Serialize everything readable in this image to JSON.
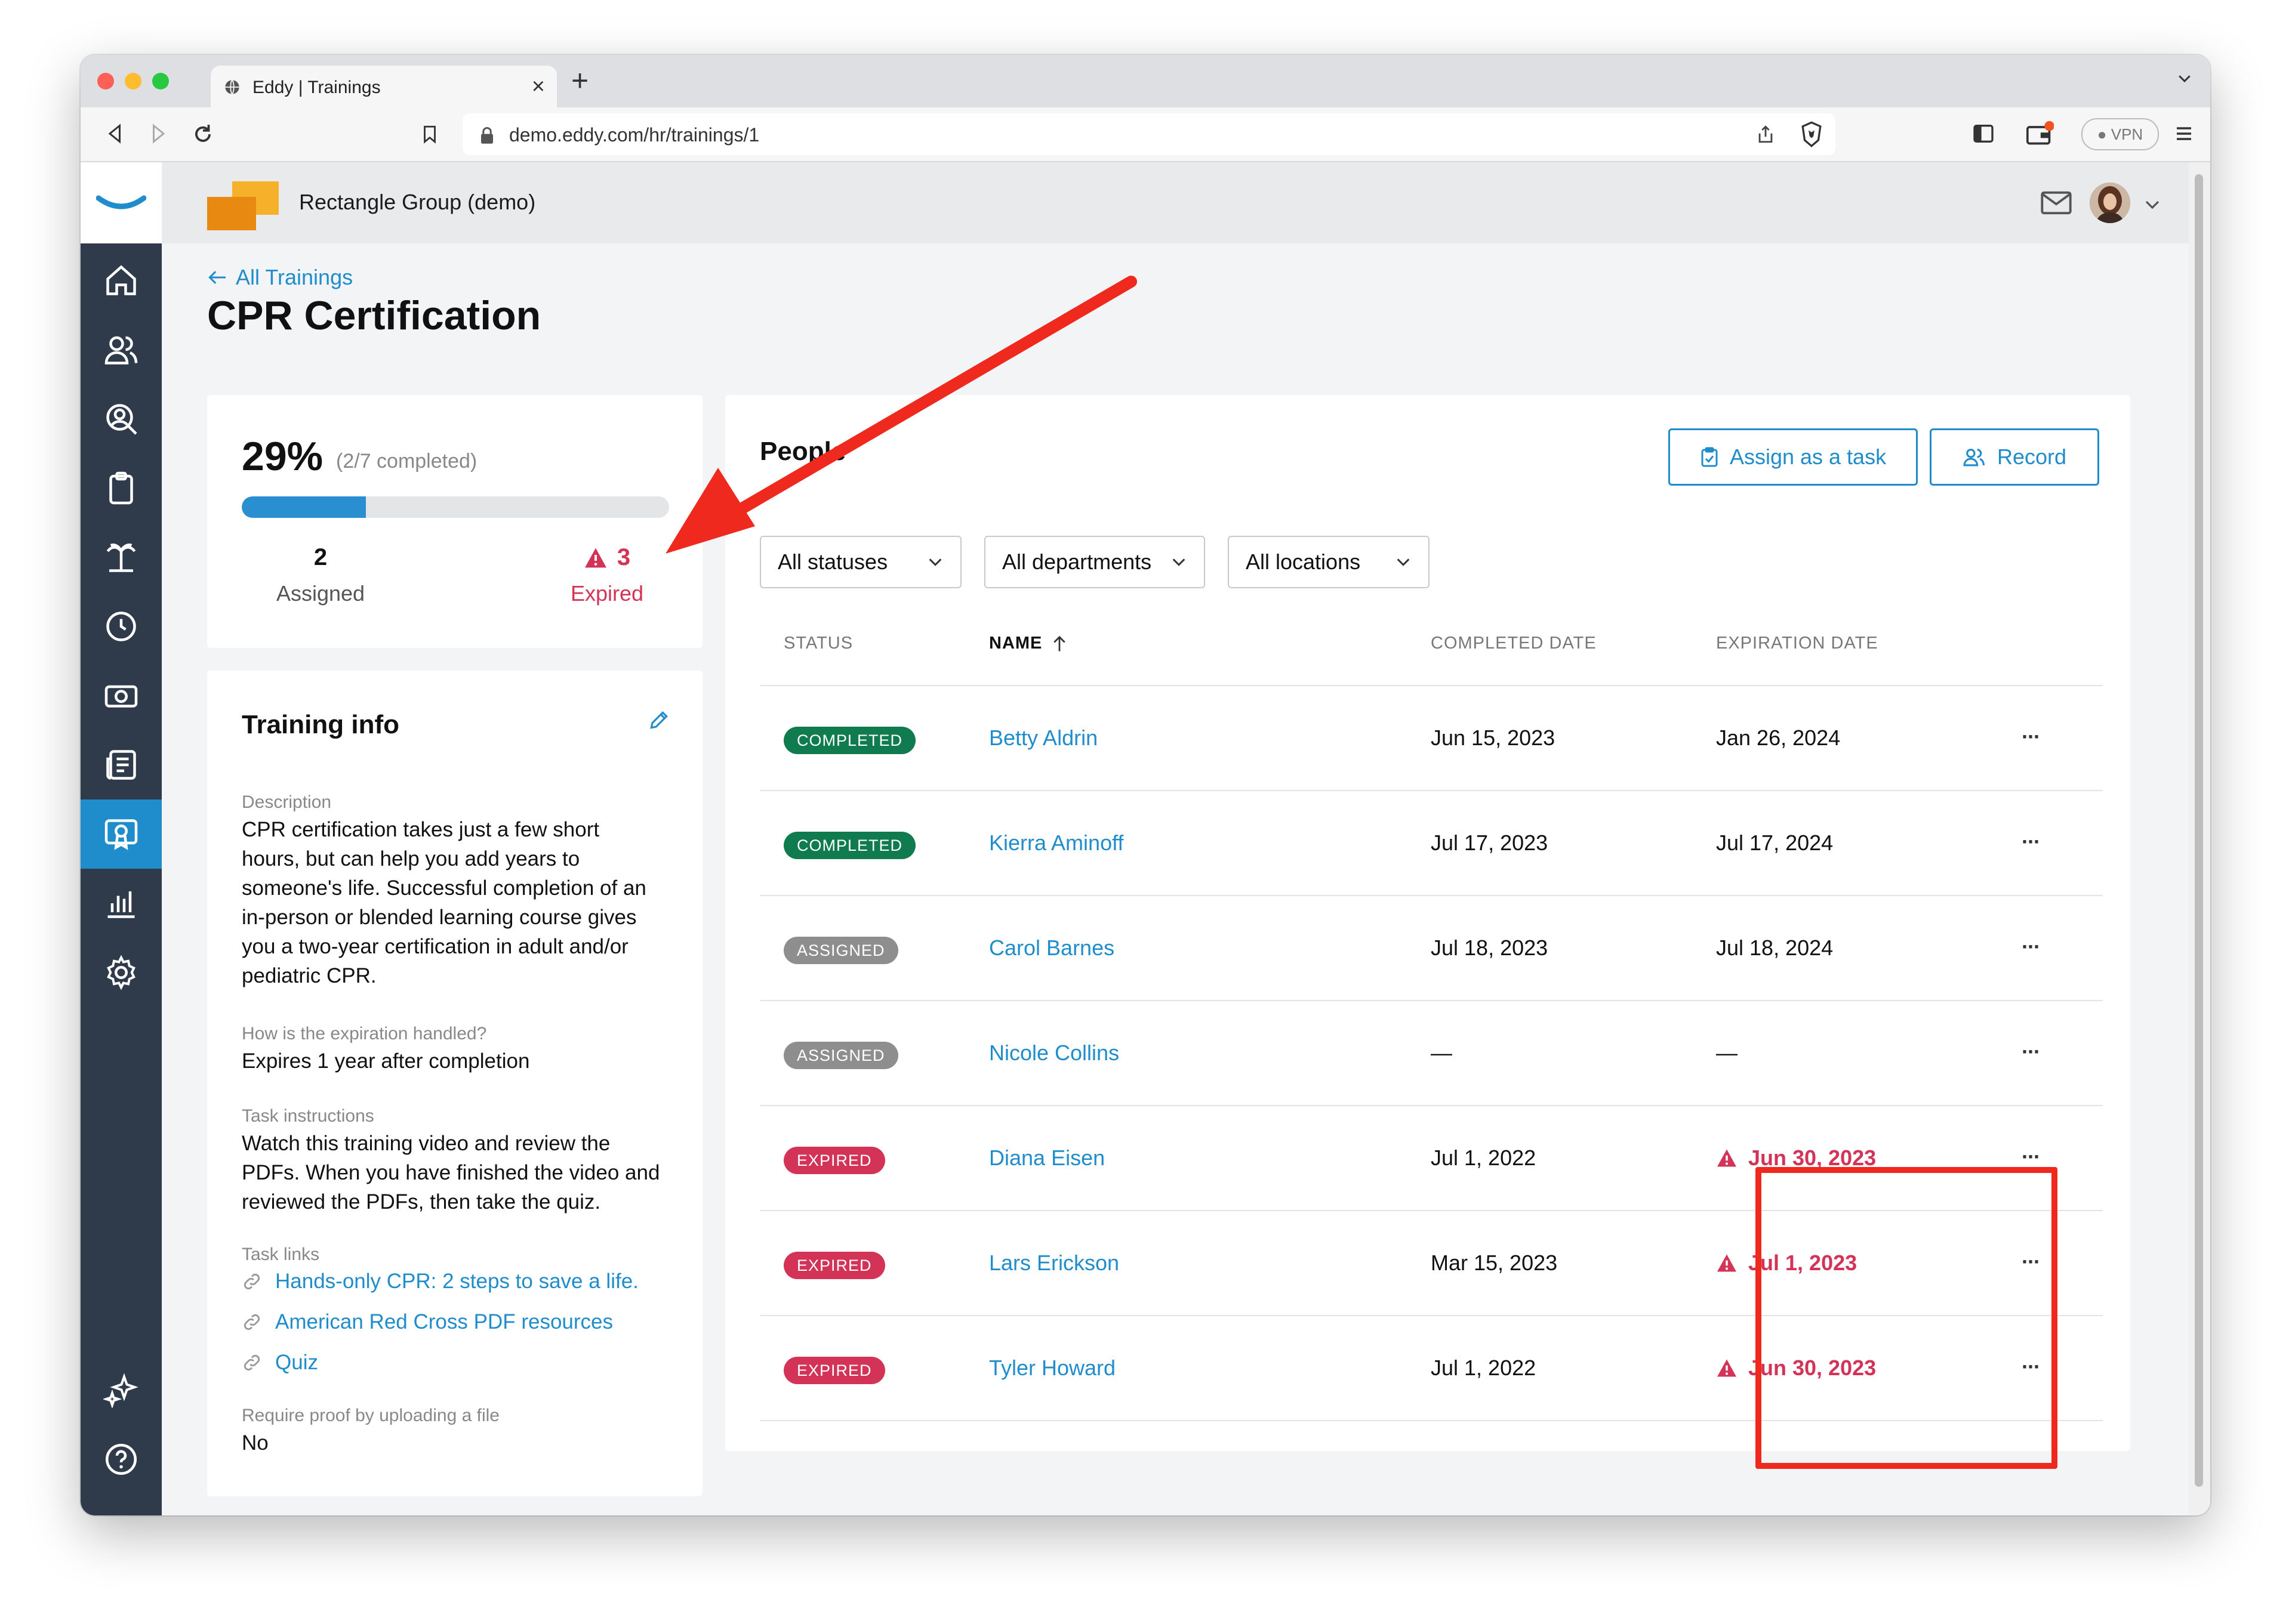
{
  "browser": {
    "tab_title": "Eddy | Trainings",
    "url": "demo.eddy.com/hr/trainings/1",
    "vpn_label": "VPN"
  },
  "header": {
    "org_name": "Rectangle Group (demo)"
  },
  "sidebar": {
    "items": [
      "home-icon",
      "people-icon",
      "search-person-icon",
      "clipboard-icon",
      "beach-icon",
      "clock-icon",
      "money-icon",
      "newspaper-icon",
      "certificate-icon",
      "chart-icon",
      "gear-icon"
    ],
    "bottom_items": [
      "sparkle-icon",
      "help-icon"
    ],
    "active_index": 8
  },
  "page": {
    "back_label": "All Trainings",
    "title": "CPR Certification"
  },
  "summary": {
    "percent": "29%",
    "completed_text": "(2/7 completed)",
    "progress": 0.29,
    "assigned_count": "2",
    "assigned_label": "Assigned",
    "expired_count": "3",
    "expired_label": "Expired"
  },
  "training_info": {
    "title": "Training info",
    "description_label": "Description",
    "description_lines": [
      "CPR certification takes just a few short",
      "hours, but can help you add years to",
      "someone's life. Successful completion of an",
      "in-person or blended learning course gives",
      "you a two-year certification in adult and/or",
      "pediatric CPR."
    ],
    "expiration_label": "How is the expiration handled?",
    "expiration_value": "Expires 1 year after completion",
    "instructions_label": "Task instructions",
    "instructions_lines": [
      "Watch this training video and review the",
      "PDFs. When you have finished the video and",
      "reviewed the PDFs, then take the quiz."
    ],
    "links_label": "Task links",
    "links": [
      "Hands-only CPR: 2 steps to save a life.",
      "American Red Cross PDF resources",
      "Quiz"
    ],
    "proof_label": "Require proof by uploading a file",
    "proof_value": "No"
  },
  "people": {
    "title": "People",
    "assign_button": "Assign as a task",
    "record_button": "Record",
    "filters": [
      "All statuses",
      "All departments",
      "All locations"
    ],
    "columns": [
      "STATUS",
      "NAME",
      "COMPLETED DATE",
      "EXPIRATION DATE"
    ],
    "rows": [
      {
        "status": "COMPLETED",
        "name": "Betty Aldrin",
        "completed": "Jun 15, 2023",
        "expiration": "Jan 26, 2024"
      },
      {
        "status": "COMPLETED",
        "name": "Kierra Aminoff",
        "completed": "Jul 17, 2023",
        "expiration": "Jul 17, 2024"
      },
      {
        "status": "ASSIGNED",
        "name": "Carol Barnes",
        "completed": "Jul 18, 2023",
        "expiration": "Jul 18, 2024"
      },
      {
        "status": "ASSIGNED",
        "name": "Nicole Collins",
        "completed": "—",
        "expiration": "—"
      },
      {
        "status": "EXPIRED",
        "name": "Diana Eisen",
        "completed": "Jul 1, 2022",
        "expiration": "Jun 30, 2023"
      },
      {
        "status": "EXPIRED",
        "name": "Lars Erickson",
        "completed": "Mar 15, 2023",
        "expiration": "Jul 1, 2023"
      },
      {
        "status": "EXPIRED",
        "name": "Tyler Howard",
        "completed": "Jul 1, 2022",
        "expiration": "Jun 30, 2023"
      }
    ],
    "row_menu": "···"
  },
  "colors": {
    "accent": "#1f8ccc",
    "completed": "#0f7b4e",
    "assigned": "#8e8e8e",
    "expired": "#d33356",
    "annotation": "#f0291e"
  }
}
